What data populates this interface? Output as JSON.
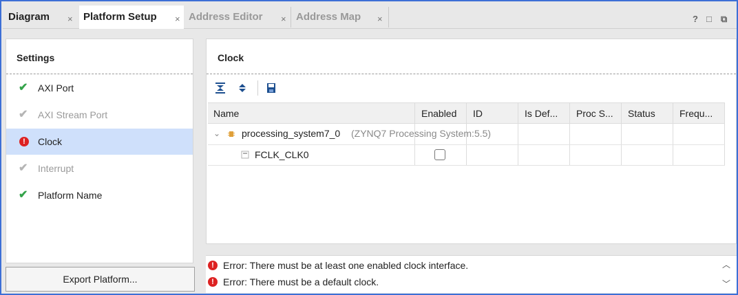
{
  "tabs": [
    {
      "label": "Diagram",
      "active": false,
      "dim": false
    },
    {
      "label": "Platform Setup",
      "active": true,
      "dim": false
    },
    {
      "label": "Address Editor",
      "active": false,
      "dim": true
    },
    {
      "label": "Address Map",
      "active": false,
      "dim": true
    }
  ],
  "close_glyph": "×",
  "window_controls": {
    "help": "?",
    "restore": "□",
    "float": "⧉"
  },
  "settings": {
    "title": "Settings",
    "items": [
      {
        "label": "AXI Port",
        "status": "ok"
      },
      {
        "label": "AXI Stream Port",
        "status": "disabled"
      },
      {
        "label": "Clock",
        "status": "error",
        "selected": true
      },
      {
        "label": "Interrupt",
        "status": "disabled"
      },
      {
        "label": "Platform Name",
        "status": "ok"
      }
    ]
  },
  "export_button": "Export Platform...",
  "clock": {
    "title": "Clock",
    "columns": [
      "Name",
      "Enabled",
      "ID",
      "Is Def...",
      "Proc S...",
      "Status",
      "Frequ..."
    ],
    "rows": [
      {
        "name": "processing_system7_0",
        "detail": "(ZYNQ7 Processing System:5.5)",
        "expanded": true
      },
      {
        "name": "FCLK_CLK0",
        "enabled": false
      }
    ]
  },
  "messages": [
    {
      "text": "Error: There must be at least one enabled clock interface."
    },
    {
      "text": "Error: There must be a default clock."
    }
  ],
  "colors": {
    "accent": "#3d6fd6",
    "selection": "#cfe0fb",
    "error": "#dd2222",
    "ok": "#34a34a"
  }
}
